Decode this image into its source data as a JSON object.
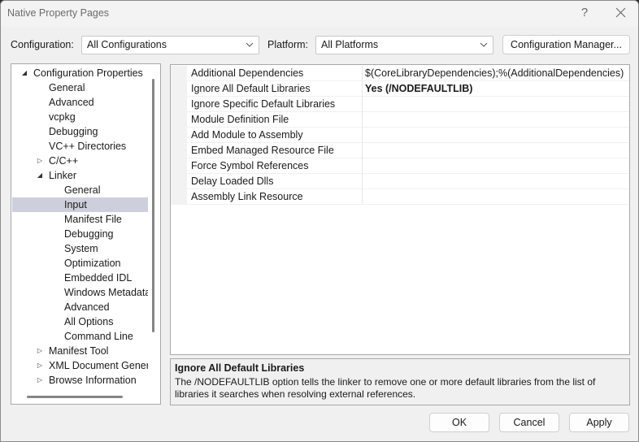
{
  "window": {
    "title": "Native Property Pages",
    "help_label": "?",
    "close_icon": "close-icon"
  },
  "toolbar": {
    "configuration_label": "Configuration:",
    "configuration_value": "All Configurations",
    "platform_label": "Platform:",
    "platform_value": "All Platforms",
    "config_manager_label": "Configuration Manager..."
  },
  "tree": {
    "items": [
      {
        "label": "Configuration Properties",
        "level": 0,
        "expander": "expanded"
      },
      {
        "label": "General",
        "level": 1,
        "expander": "none"
      },
      {
        "label": "Advanced",
        "level": 1,
        "expander": "none"
      },
      {
        "label": "vcpkg",
        "level": 1,
        "expander": "none"
      },
      {
        "label": "Debugging",
        "level": 1,
        "expander": "none"
      },
      {
        "label": "VC++ Directories",
        "level": 1,
        "expander": "none"
      },
      {
        "label": "C/C++",
        "level": 1,
        "expander": "collapsed"
      },
      {
        "label": "Linker",
        "level": 1,
        "expander": "expanded"
      },
      {
        "label": "General",
        "level": 2,
        "expander": "none"
      },
      {
        "label": "Input",
        "level": 2,
        "expander": "none",
        "selected": true
      },
      {
        "label": "Manifest File",
        "level": 2,
        "expander": "none"
      },
      {
        "label": "Debugging",
        "level": 2,
        "expander": "none"
      },
      {
        "label": "System",
        "level": 2,
        "expander": "none"
      },
      {
        "label": "Optimization",
        "level": 2,
        "expander": "none"
      },
      {
        "label": "Embedded IDL",
        "level": 2,
        "expander": "none"
      },
      {
        "label": "Windows Metadata",
        "level": 2,
        "expander": "none"
      },
      {
        "label": "Advanced",
        "level": 2,
        "expander": "none"
      },
      {
        "label": "All Options",
        "level": 2,
        "expander": "none"
      },
      {
        "label": "Command Line",
        "level": 2,
        "expander": "none"
      },
      {
        "label": "Manifest Tool",
        "level": 1,
        "expander": "collapsed"
      },
      {
        "label": "XML Document Generator",
        "level": 1,
        "expander": "collapsed"
      },
      {
        "label": "Browse Information",
        "level": 1,
        "expander": "collapsed"
      }
    ]
  },
  "properties": {
    "rows": [
      {
        "name": "Additional Dependencies",
        "value": "$(CoreLibraryDependencies);%(AdditionalDependencies)",
        "bold": false
      },
      {
        "name": "Ignore All Default Libraries",
        "value": "Yes (/NODEFAULTLIB)",
        "bold": true
      },
      {
        "name": "Ignore Specific Default Libraries",
        "value": "",
        "bold": false
      },
      {
        "name": "Module Definition File",
        "value": "",
        "bold": false
      },
      {
        "name": "Add Module to Assembly",
        "value": "",
        "bold": false
      },
      {
        "name": "Embed Managed Resource File",
        "value": "",
        "bold": false
      },
      {
        "name": "Force Symbol References",
        "value": "",
        "bold": false
      },
      {
        "name": "Delay Loaded Dlls",
        "value": "",
        "bold": false
      },
      {
        "name": "Assembly Link Resource",
        "value": "",
        "bold": false
      }
    ]
  },
  "description": {
    "title": "Ignore All Default Libraries",
    "text": "The /NODEFAULTLIB option tells the linker to remove one or more default libraries from the list of libraries it searches when resolving external references."
  },
  "buttons": {
    "ok": "OK",
    "cancel": "Cancel",
    "apply": "Apply"
  }
}
